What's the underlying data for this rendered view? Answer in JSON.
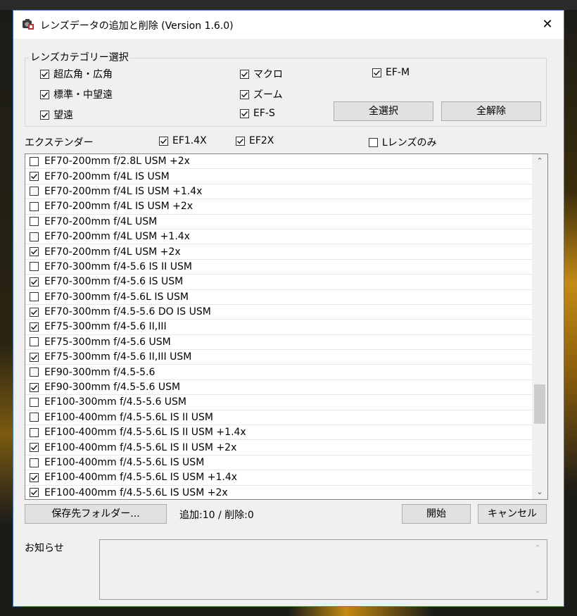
{
  "window": {
    "title": "レンズデータの追加と削除 (Version 1.6.0)",
    "close": "✕"
  },
  "category": {
    "legend": "レンズカテゴリー選択",
    "items": [
      {
        "label": "超広角・広角",
        "checked": true
      },
      {
        "label": "標準・中望遠",
        "checked": true
      },
      {
        "label": "望遠",
        "checked": true
      },
      {
        "label": "マクロ",
        "checked": true
      },
      {
        "label": "ズーム",
        "checked": true
      },
      {
        "label": "EF-S",
        "checked": true
      },
      {
        "label": "EF-M",
        "checked": true
      }
    ],
    "select_all": "全選択",
    "deselect_all": "全解除"
  },
  "extender": {
    "label": "エクステンダー",
    "items": [
      {
        "label": "EF1.4X",
        "checked": true
      },
      {
        "label": "EF2X",
        "checked": true
      }
    ],
    "l_lens_only": {
      "label": "Lレンズのみ",
      "checked": false
    }
  },
  "lenses": [
    {
      "name": "EF70-200mm f/2.8L USM +2x",
      "checked": false
    },
    {
      "name": "EF70-200mm f/4L IS USM",
      "checked": true
    },
    {
      "name": "EF70-200mm f/4L IS USM +1.4x",
      "checked": false
    },
    {
      "name": "EF70-200mm f/4L IS USM +2x",
      "checked": false
    },
    {
      "name": "EF70-200mm f/4L USM",
      "checked": false
    },
    {
      "name": "EF70-200mm f/4L USM +1.4x",
      "checked": false
    },
    {
      "name": "EF70-200mm f/4L USM +2x",
      "checked": true
    },
    {
      "name": "EF70-300mm f/4-5.6 IS II USM",
      "checked": false
    },
    {
      "name": "EF70-300mm f/4-5.6 IS USM",
      "checked": true
    },
    {
      "name": "EF70-300mm f/4-5.6L IS USM",
      "checked": false
    },
    {
      "name": "EF70-300mm f/4.5-5.6 DO IS USM",
      "checked": true
    },
    {
      "name": "EF75-300mm f/4-5.6 II,III",
      "checked": true
    },
    {
      "name": "EF75-300mm f/4-5.6 USM",
      "checked": false
    },
    {
      "name": "EF75-300mm f/4-5.6 II,III USM",
      "checked": true
    },
    {
      "name": "EF90-300mm f/4.5-5.6",
      "checked": false
    },
    {
      "name": "EF90-300mm f/4.5-5.6 USM",
      "checked": true
    },
    {
      "name": "EF100-300mm f/4.5-5.6 USM",
      "checked": false
    },
    {
      "name": "EF100-400mm f/4.5-5.6L IS II USM",
      "checked": false
    },
    {
      "name": "EF100-400mm f/4.5-5.6L IS II USM +1.4x",
      "checked": false
    },
    {
      "name": "EF100-400mm f/4.5-5.6L IS II USM +2x",
      "checked": true
    },
    {
      "name": "EF100-400mm f/4.5-5.6L IS USM",
      "checked": false
    },
    {
      "name": "EF100-400mm f/4.5-5.6L IS USM +1.4x",
      "checked": true
    },
    {
      "name": "EF100-400mm f/4.5-5.6L IS USM +2x",
      "checked": true
    }
  ],
  "scroll": {
    "up": "⌃",
    "down": "⌄"
  },
  "footer": {
    "save_folder": "保存先フォルダー...",
    "status": "追加:10 / 削除:0",
    "start": "開始",
    "cancel": "キャンセル"
  },
  "notice": {
    "label": "お知らせ",
    "text": ""
  }
}
